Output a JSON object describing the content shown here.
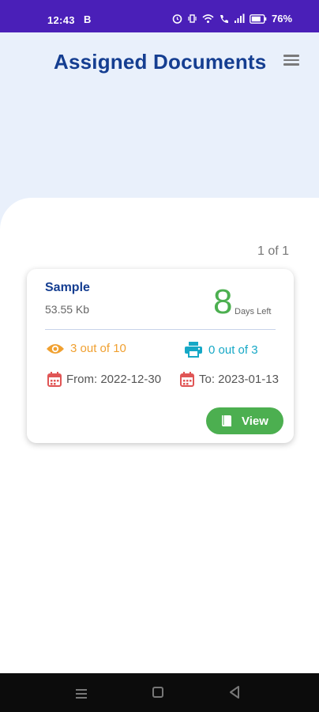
{
  "status_bar": {
    "time": "12:43",
    "sim_icon": "B",
    "battery": "76%",
    "icons": [
      "alarm-icon",
      "vibrate-icon",
      "wifi-icon",
      "call-icon",
      "signal-icon",
      "battery-icon"
    ]
  },
  "header": {
    "title": "Assigned Documents",
    "menu_icon": "menu-icon",
    "background": "#e9f0fb",
    "title_color": "#153e91"
  },
  "pagination": "1 of 1",
  "document": {
    "name": "Sample",
    "size": "53.55 Kb",
    "days_left": "8",
    "days_label": "Days Left",
    "views": "3 out of 10",
    "prints": "0 out of 3",
    "from": "From: 2022-12-30",
    "to": "To: 2023-01-13",
    "view_button": "View"
  },
  "colors": {
    "accent_green": "#4caf50",
    "views_orange": "#f0a030",
    "prints_teal": "#16a8c6",
    "calendar_red": "#e05555",
    "status_bar": "#4a1fb8"
  }
}
